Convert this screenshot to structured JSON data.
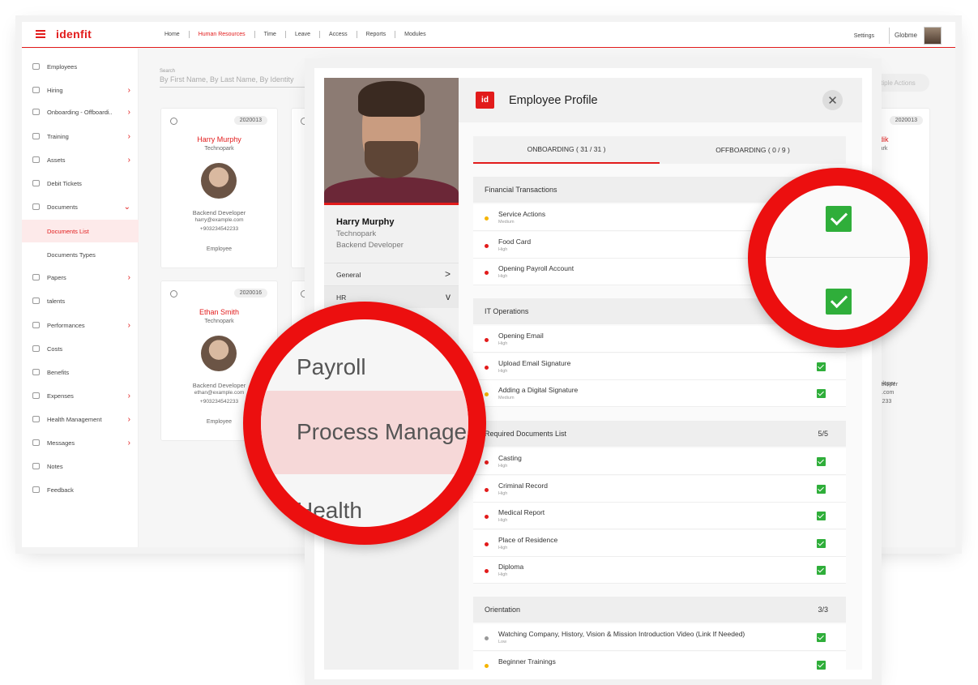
{
  "app": {
    "logo": "idenfit",
    "nav": [
      "Home",
      "Human Resources",
      "Time",
      "Leave",
      "Access",
      "Reports",
      "Modules"
    ],
    "nav_active": "Human Resources",
    "settings": "Settings",
    "user": "Globme"
  },
  "sidebar": [
    {
      "label": "Employees",
      "chevron": false
    },
    {
      "label": "Hiring",
      "chevron": true
    },
    {
      "label": "Onboarding - Offboardi..",
      "chevron": true
    },
    {
      "label": "Training",
      "chevron": true
    },
    {
      "label": "Assets",
      "chevron": true
    },
    {
      "label": "Debit Tickets",
      "chevron": false
    },
    {
      "label": "Documents",
      "chevron": true
    },
    {
      "label": "Documents List",
      "chevron": false
    },
    {
      "label": "Documents Types",
      "chevron": false
    },
    {
      "label": "Papers",
      "chevron": true
    },
    {
      "label": "talents",
      "chevron": false
    },
    {
      "label": "Performances",
      "chevron": true
    },
    {
      "label": "Costs",
      "chevron": false
    },
    {
      "label": "Benefits",
      "chevron": false
    },
    {
      "label": "Expenses",
      "chevron": true
    },
    {
      "label": "Health Management",
      "chevron": true
    },
    {
      "label": "Messages",
      "chevron": true
    },
    {
      "label": "Notes",
      "chevron": false
    },
    {
      "label": "Feedback",
      "chevron": false
    }
  ],
  "search": {
    "label": "Search",
    "placeholder": "By First Name, By Last Name, By Identity"
  },
  "multiple_actions": "Multiple Actions",
  "cards": [
    {
      "id": "2020013",
      "name": "Harry Murphy",
      "company": "Technopark",
      "role": "Backend Developer",
      "email": "harry@example.com",
      "phone": "+903234542233",
      "type": "Employee"
    },
    {
      "id": "2020016",
      "name": "Ethan Smith",
      "company": "Technopark",
      "role": "Backend Developer",
      "email": "ethan@example.com",
      "phone": "+903234542233",
      "type": "Employee"
    },
    {
      "id": "2020013",
      "name": "Sadik",
      "company": "nopark",
      "role": "Deceloper",
      "email": "mple.com",
      "phone": "4542233",
      "type": "oyee"
    }
  ],
  "profile": {
    "title": "Employee Profile",
    "logo": "id",
    "name": "Harry Murphy",
    "company": "Technopark",
    "role": "Backend Developer",
    "menu": [
      {
        "label": "General",
        "chevron": ">"
      },
      {
        "label": "HR",
        "chevron": "v"
      }
    ],
    "tabs": [
      "ONBOARDING ( 31 / 31 )",
      "OFFBOARDING ( 0 / 9 )"
    ],
    "sections": [
      {
        "title": "Financial Transactions",
        "count": "",
        "items": [
          {
            "name": "Service Actions",
            "priority": "Medium",
            "color": "#f5b400"
          },
          {
            "name": "Food Card",
            "priority": "High",
            "color": "#e21b1b"
          },
          {
            "name": "Opening Payroll Account",
            "priority": "High",
            "color": "#e21b1b"
          }
        ]
      },
      {
        "title": "IT Operations",
        "count": "",
        "items": [
          {
            "name": "Opening Email",
            "priority": "High",
            "color": "#e21b1b"
          },
          {
            "name": "Upload Email Signature",
            "priority": "High",
            "color": "#e21b1b"
          },
          {
            "name": "Adding a Digital Signature",
            "priority": "Medium",
            "color": "#f5b400"
          }
        ]
      },
      {
        "title": "Required Documents List",
        "count": "5/5",
        "items": [
          {
            "name": "Casting",
            "priority": "High",
            "color": "#e21b1b"
          },
          {
            "name": "Criminal Record",
            "priority": "High",
            "color": "#e21b1b"
          },
          {
            "name": "Medical Report",
            "priority": "High",
            "color": "#e21b1b"
          },
          {
            "name": "Place of Residence",
            "priority": "High",
            "color": "#e21b1b"
          },
          {
            "name": "Diploma",
            "priority": "High",
            "color": "#e21b1b"
          }
        ]
      },
      {
        "title": "Orientation",
        "count": "3/3",
        "items": [
          {
            "name": "Watching Company, History, Vision & Mission Introduction Video (Link If Needed)",
            "priority": "Low",
            "color": "#999999"
          },
          {
            "name": "Beginner Trainings",
            "priority": "",
            "color": "#f5b400"
          }
        ]
      }
    ]
  },
  "zoom_menu": [
    "Payroll",
    "Process Manage",
    "Health"
  ],
  "colors": {
    "accent": "#e21b1b",
    "success": "#2fae3a",
    "medium": "#f5b400",
    "low": "#999999"
  }
}
